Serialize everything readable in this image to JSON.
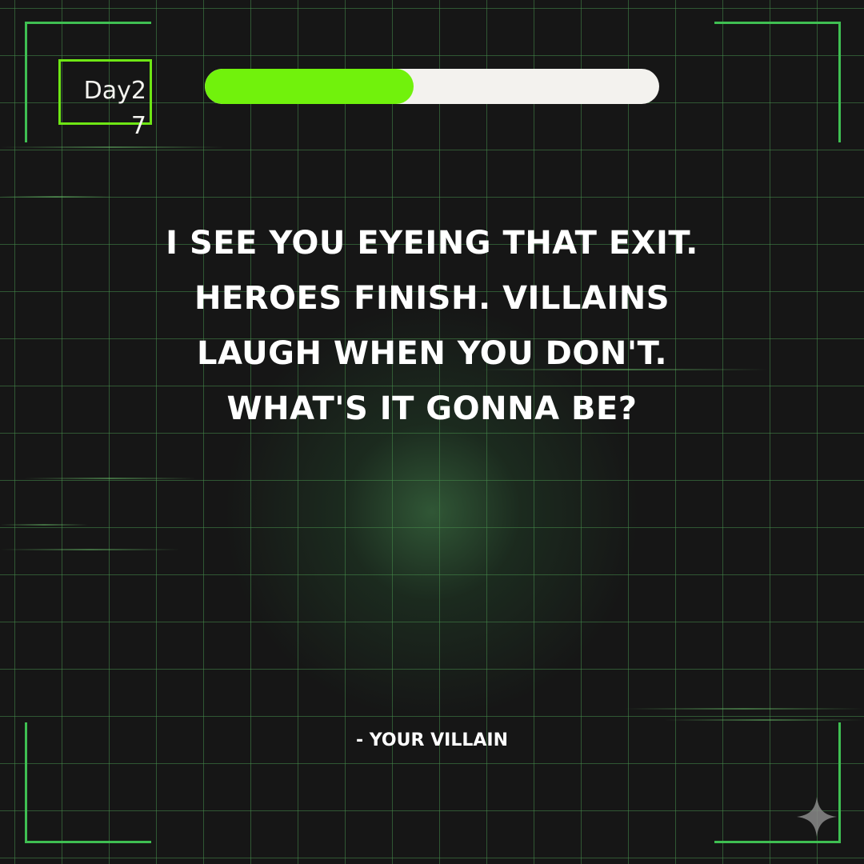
{
  "header": {
    "day_label": "Day27",
    "progress": 0.46
  },
  "quote": {
    "text": "I SEE YOU EYEING THAT EXIT. HEROES FINISH. VILLAINS LAUGH WHEN YOU DON'T. WHAT'S IT GONNA BE?",
    "signature": "- YOUR VILLAIN"
  },
  "colors": {
    "accent_green": "#71f20c",
    "frame_green": "#3fbf52",
    "background": "#161616",
    "text": "#ffffff"
  },
  "icons": {
    "watermark": "sparkle-icon"
  }
}
